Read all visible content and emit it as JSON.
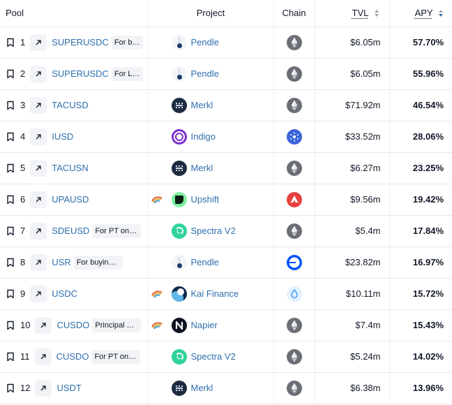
{
  "headers": {
    "pool": "Pool",
    "project": "Project",
    "chain": "Chain",
    "tvl": "TVL",
    "apy": "APY"
  },
  "rows": [
    {
      "rank": "1",
      "pool": "SUPERUSDC",
      "tag": "For b…",
      "project": "Pendle",
      "project_icon": "pendle-logo",
      "chain_icon": "ethereum-icon",
      "tvl": "$6.05m",
      "apy": "57.70%",
      "rainbow": false
    },
    {
      "rank": "2",
      "pool": "SUPERUSDC",
      "tag": "For L…",
      "project": "Pendle",
      "project_icon": "pendle-logo",
      "chain_icon": "ethereum-icon",
      "tvl": "$6.05m",
      "apy": "55.96%",
      "rainbow": false
    },
    {
      "rank": "3",
      "pool": "TACUSD",
      "tag": "",
      "project": "Merkl",
      "project_icon": "merkl-logo",
      "chain_icon": "ethereum-icon",
      "tvl": "$71.92m",
      "apy": "46.54%",
      "rainbow": false
    },
    {
      "rank": "4",
      "pool": "IUSD",
      "tag": "",
      "project": "Indigo",
      "project_icon": "indigo-logo",
      "chain_icon": "cardano-icon",
      "tvl": "$33.52m",
      "apy": "28.06%",
      "rainbow": false
    },
    {
      "rank": "5",
      "pool": "TACUSN",
      "tag": "",
      "project": "Merkl",
      "project_icon": "merkl-logo",
      "chain_icon": "ethereum-icon",
      "tvl": "$6.27m",
      "apy": "23.25%",
      "rainbow": false
    },
    {
      "rank": "6",
      "pool": "UPAUSD",
      "tag": "",
      "project": "Upshift",
      "project_icon": "upshift-logo",
      "chain_icon": "avalanche-icon",
      "tvl": "$9.56m",
      "apy": "19.42%",
      "rainbow": true
    },
    {
      "rank": "7",
      "pool": "SDEUSD",
      "tag": "For PT on …",
      "project": "Spectra V2",
      "project_icon": "spectra-logo",
      "chain_icon": "ethereum-icon",
      "tvl": "$5.4m",
      "apy": "17.84%",
      "rainbow": false
    },
    {
      "rank": "8",
      "pool": "USR",
      "tag": "For buying PT-…",
      "project": "Pendle",
      "project_icon": "pendle-logo",
      "chain_icon": "base-icon",
      "tvl": "$23.82m",
      "apy": "16.97%",
      "rainbow": false
    },
    {
      "rank": "9",
      "pool": "USDC",
      "tag": "",
      "project": "Kai Finance",
      "project_icon": "kai-logo",
      "chain_icon": "sui-icon",
      "tvl": "$10.11m",
      "apy": "15.72%",
      "rainbow": true
    },
    {
      "rank": "10",
      "pool": "CUSDO",
      "tag": "Principal T…",
      "project": "Napier",
      "project_icon": "napier-logo",
      "chain_icon": "ethereum-icon",
      "tvl": "$7.4m",
      "apy": "15.43%",
      "rainbow": true
    },
    {
      "rank": "11",
      "pool": "CUSDO",
      "tag": "For PT on …",
      "project": "Spectra V2",
      "project_icon": "spectra-logo",
      "chain_icon": "ethereum-icon",
      "tvl": "$5.24m",
      "apy": "14.02%",
      "rainbow": false
    },
    {
      "rank": "12",
      "pool": "USDT",
      "tag": "",
      "project": "Merkl",
      "project_icon": "merkl-logo",
      "chain_icon": "ethereum-icon",
      "tvl": "$6.38m",
      "apy": "13.96%",
      "rainbow": false
    }
  ],
  "colors": {
    "link": "#2f6fad",
    "sort_active": "#2f6fad",
    "border": "#e5e7eb"
  }
}
